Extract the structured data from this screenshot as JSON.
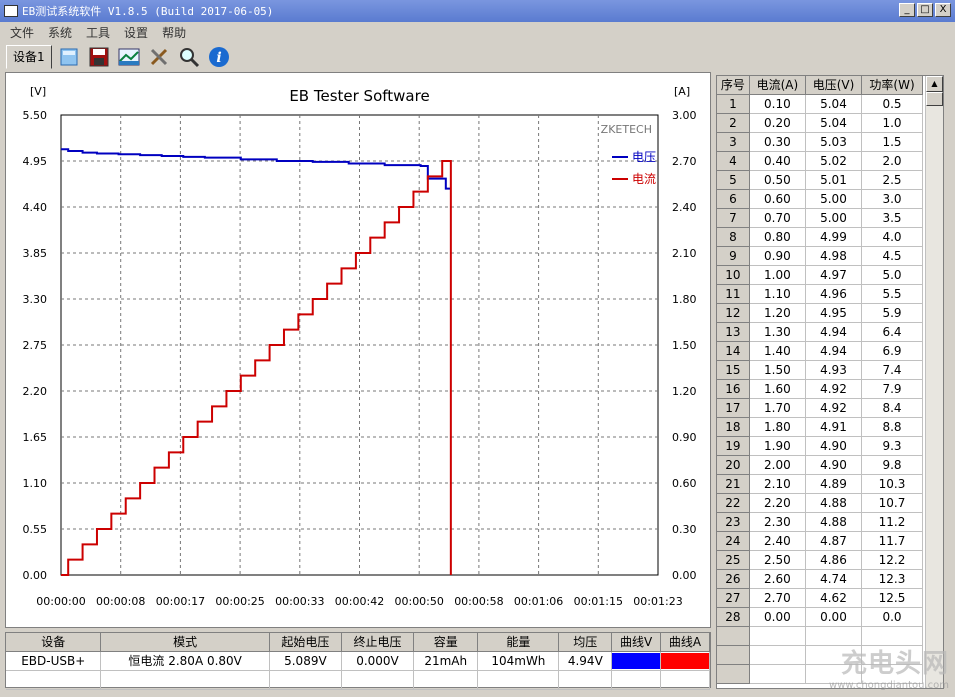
{
  "window": {
    "title": "EB测试系统软件 V1.8.5 (Build 2017-06-05)",
    "min": "_",
    "max": "□",
    "close": "X"
  },
  "menu": [
    "文件",
    "系统",
    "工具",
    "设置",
    "帮助"
  ],
  "toolbar": {
    "tab_label": "设备1",
    "icons": [
      "open-icon",
      "save-icon",
      "chart-icon",
      "tools-icon",
      "search-icon",
      "info-icon"
    ]
  },
  "chart_data": {
    "type": "line",
    "title": "EB Tester Software",
    "brand": "ZKETECH",
    "y_left_unit": "[V]",
    "y_right_unit": "[A]",
    "y_left_ticks": [
      "5.50",
      "4.95",
      "4.40",
      "3.85",
      "3.30",
      "2.75",
      "2.20",
      "1.65",
      "1.10",
      "0.55",
      "0.00"
    ],
    "y_right_ticks": [
      "3.00",
      "2.70",
      "2.40",
      "2.10",
      "1.80",
      "1.50",
      "1.20",
      "0.90",
      "0.60",
      "0.30",
      "0.00"
    ],
    "x_ticks": [
      "00:00:00",
      "00:00:08",
      "00:00:17",
      "00:00:25",
      "00:00:33",
      "00:00:42",
      "00:00:50",
      "00:00:58",
      "00:01:06",
      "00:01:15",
      "00:01:23"
    ],
    "ylim_left": [
      0,
      5.5
    ],
    "ylim_right": [
      0,
      3.0
    ],
    "xlim_seconds": [
      0,
      83
    ],
    "series": [
      {
        "name": "电压",
        "axis": "left",
        "color": "#0000c0",
        "x": [
          0,
          1,
          3,
          5,
          8,
          11,
          14,
          17,
          20,
          25,
          30,
          35,
          40,
          45,
          50,
          51,
          51.5,
          53,
          53.5,
          54,
          54.2
        ],
        "y": [
          5.09,
          5.07,
          5.05,
          5.04,
          5.03,
          5.02,
          5.01,
          5.0,
          4.99,
          4.97,
          4.95,
          4.94,
          4.92,
          4.9,
          4.89,
          4.74,
          4.74,
          4.74,
          4.62,
          4.62,
          4.62
        ]
      },
      {
        "name": "电流",
        "axis": "right",
        "color": "#cc0000",
        "x": [
          0,
          1,
          3,
          5,
          7,
          9,
          11,
          13,
          15,
          17,
          19,
          21,
          23,
          25,
          27,
          29,
          31,
          33,
          35,
          37,
          39,
          41,
          43,
          45,
          47,
          49,
          51,
          53,
          54.2,
          54.2
        ],
        "y": [
          0.0,
          0.1,
          0.2,
          0.3,
          0.4,
          0.5,
          0.6,
          0.7,
          0.8,
          0.9,
          1.0,
          1.1,
          1.2,
          1.3,
          1.4,
          1.5,
          1.6,
          1.7,
          1.8,
          1.9,
          2.0,
          2.1,
          2.2,
          2.3,
          2.4,
          2.5,
          2.6,
          2.7,
          2.7,
          0.0
        ]
      }
    ]
  },
  "table": {
    "headers": [
      "序号",
      "电流(A)",
      "电压(V)",
      "功率(W)"
    ],
    "rows": [
      [
        "1",
        "0.10",
        "5.04",
        "0.5"
      ],
      [
        "2",
        "0.20",
        "5.04",
        "1.0"
      ],
      [
        "3",
        "0.30",
        "5.03",
        "1.5"
      ],
      [
        "4",
        "0.40",
        "5.02",
        "2.0"
      ],
      [
        "5",
        "0.50",
        "5.01",
        "2.5"
      ],
      [
        "6",
        "0.60",
        "5.00",
        "3.0"
      ],
      [
        "7",
        "0.70",
        "5.00",
        "3.5"
      ],
      [
        "8",
        "0.80",
        "4.99",
        "4.0"
      ],
      [
        "9",
        "0.90",
        "4.98",
        "4.5"
      ],
      [
        "10",
        "1.00",
        "4.97",
        "5.0"
      ],
      [
        "11",
        "1.10",
        "4.96",
        "5.5"
      ],
      [
        "12",
        "1.20",
        "4.95",
        "5.9"
      ],
      [
        "13",
        "1.30",
        "4.94",
        "6.4"
      ],
      [
        "14",
        "1.40",
        "4.94",
        "6.9"
      ],
      [
        "15",
        "1.50",
        "4.93",
        "7.4"
      ],
      [
        "16",
        "1.60",
        "4.92",
        "7.9"
      ],
      [
        "17",
        "1.70",
        "4.92",
        "8.4"
      ],
      [
        "18",
        "1.80",
        "4.91",
        "8.8"
      ],
      [
        "19",
        "1.90",
        "4.90",
        "9.3"
      ],
      [
        "20",
        "2.00",
        "4.90",
        "9.8"
      ],
      [
        "21",
        "2.10",
        "4.89",
        "10.3"
      ],
      [
        "22",
        "2.20",
        "4.88",
        "10.7"
      ],
      [
        "23",
        "2.30",
        "4.88",
        "11.2"
      ],
      [
        "24",
        "2.40",
        "4.87",
        "11.7"
      ],
      [
        "25",
        "2.50",
        "4.86",
        "12.2"
      ],
      [
        "26",
        "2.60",
        "4.74",
        "12.3"
      ],
      [
        "27",
        "2.70",
        "4.62",
        "12.5"
      ],
      [
        "28",
        "0.00",
        "0.00",
        "0.0"
      ],
      [
        "",
        "",
        "",
        ""
      ],
      [
        "",
        "",
        "",
        ""
      ],
      [
        "",
        "",
        "",
        ""
      ]
    ]
  },
  "info": {
    "headers": [
      "设备",
      "模式",
      "起始电压",
      "终止电压",
      "容量",
      "能量",
      "均压",
      "曲线V",
      "曲线A"
    ],
    "values": [
      "EBD-USB+",
      "恒电流  2.80A  0.80V",
      "5.089V",
      "0.000V",
      "21mAh",
      "104mWh",
      "4.94V",
      "",
      ""
    ],
    "curve_v_color": "#0000ff",
    "curve_a_color": "#ff0000"
  },
  "watermark": {
    "text": "充电头网",
    "url": "www.chongdiantou.com"
  }
}
